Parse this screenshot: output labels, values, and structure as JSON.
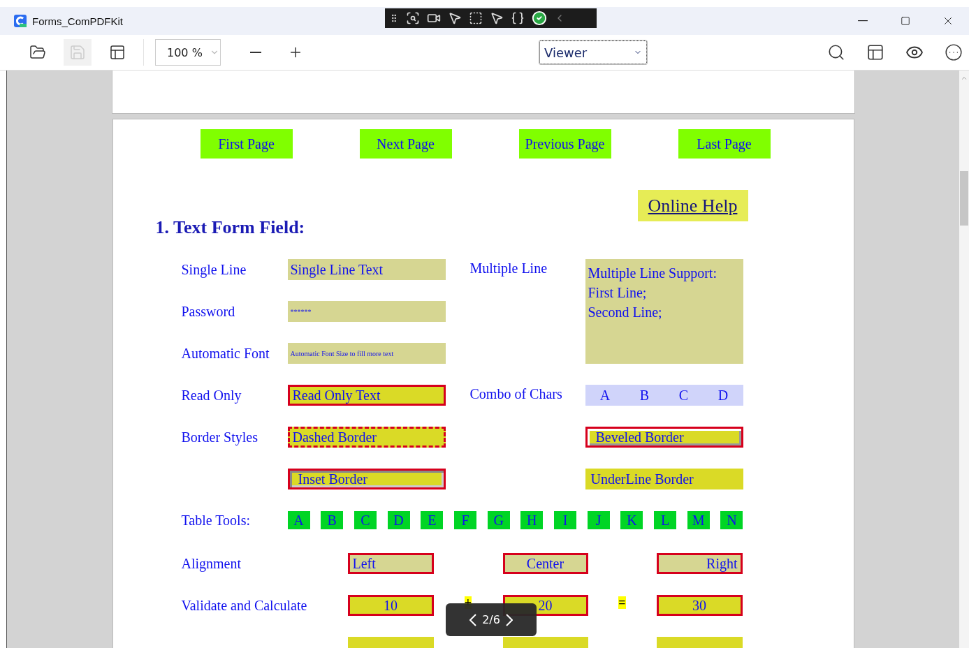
{
  "window": {
    "title": "Forms_ComPDFKit"
  },
  "toolbar": {
    "save_disabled": true,
    "zoom": "100 %",
    "mode": "Viewer"
  },
  "page": {
    "nav_buttons": [
      "First Page",
      "Next Page",
      "Previous Page",
      "Last Page"
    ],
    "help_link": "Online Help",
    "heading": "1. Text Form Field:",
    "left_fields": [
      {
        "label": "Single Line",
        "value": "Single Line Text",
        "kind": "plain"
      },
      {
        "label": "Password",
        "value": "******",
        "kind": "small"
      },
      {
        "label": "Automatic Font",
        "value": "Automatic Font Size to fill more text",
        "kind": "tiny"
      },
      {
        "label": "Read Only",
        "value": "Read Only Text",
        "kind": "readonly"
      },
      {
        "label": "Border Styles",
        "value": "Dashed Border",
        "kind": "dashed"
      },
      {
        "value": "Inset Border",
        "kind": "inset"
      }
    ],
    "right_fields": [
      {
        "label": "Multiple Line",
        "value": "Multiple Line Support:\nFirst Line;\nSecond Line;",
        "kind": "multiline"
      },
      {
        "label": "Combo of Chars",
        "chars": [
          "A",
          "B",
          "C",
          "D"
        ],
        "kind": "comb"
      },
      {
        "value": "Beveled Border",
        "kind": "beveled"
      },
      {
        "value": "UnderLine Border",
        "kind": "underline"
      }
    ],
    "table_tools": {
      "label": "Table Tools:",
      "buttons": [
        "A",
        "B",
        "C",
        "D",
        "E",
        "F",
        "G",
        "H",
        "I",
        "J",
        "K",
        "L",
        "M",
        "N"
      ]
    },
    "alignment": {
      "label": "Alignment",
      "fields": [
        {
          "value": "Left",
          "kind": "left"
        },
        {
          "value": "Center",
          "kind": "center"
        },
        {
          "value": "Right",
          "kind": "right"
        }
      ]
    },
    "validate": {
      "label": "Validate and Calculate",
      "values": [
        "10",
        "20",
        "30"
      ],
      "operators": [
        "+",
        "="
      ]
    }
  },
  "pager": {
    "label": "2/6"
  }
}
